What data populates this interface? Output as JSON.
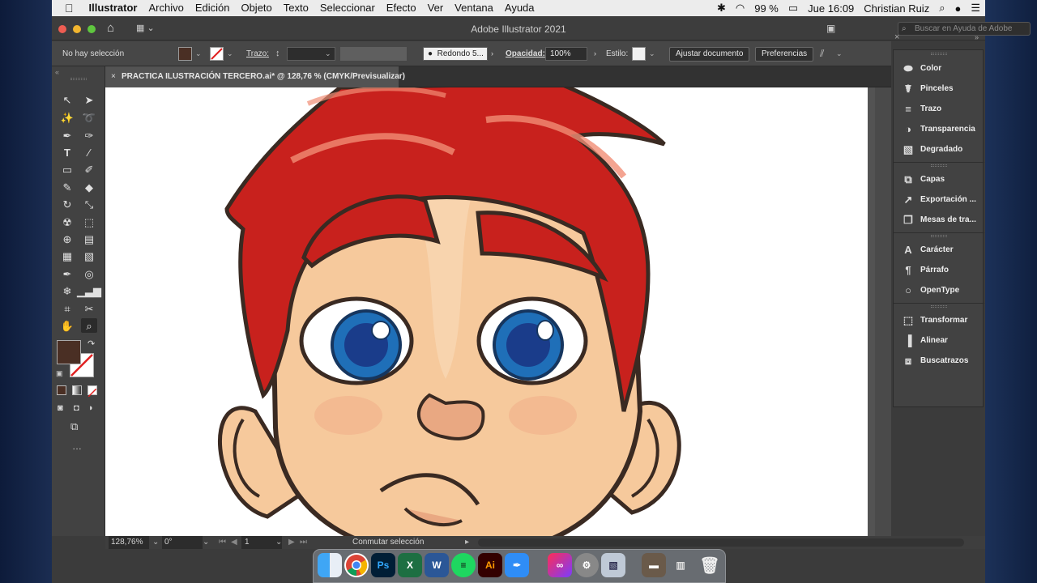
{
  "menubar": {
    "apple_icon": "apple-icon",
    "app_name": "Illustrator",
    "items": [
      "Archivo",
      "Edición",
      "Objeto",
      "Texto",
      "Seleccionar",
      "Efecto",
      "Ver",
      "Ventana",
      "Ayuda"
    ],
    "battery": "99 %",
    "clock": "Jue 16:09",
    "user": "Christian Ruiz"
  },
  "titlebar": {
    "title": "Adobe Illustrator 2021",
    "search_placeholder": "Buscar en Ayuda de Adobe"
  },
  "control_bar": {
    "selection": "No hay selección",
    "stroke_label": "Trazo:",
    "brush": "Redondo 5...",
    "opacity_label": "Opacidad:",
    "opacity_value": "100%",
    "style_label": "Estilo:",
    "doc_setup_button": "Ajustar documento",
    "preferences_button": "Preferencias",
    "fill_color": "#4a2f24"
  },
  "document_tab": {
    "close": "×",
    "label": "PRACTICA ILUSTRACIÓN TERCERO.ai* @ 128,76 % (CMYK/Previsualizar)"
  },
  "status_bar": {
    "zoom": "128,76%",
    "rotation": "0°",
    "artboard": "1",
    "info": "Conmutar selección"
  },
  "panels": [
    {
      "label": "Color",
      "icon": "color-palette-icon"
    },
    {
      "label": "Pinceles",
      "icon": "brush-icon"
    },
    {
      "label": "Trazo",
      "icon": "stroke-lines-icon"
    },
    {
      "label": "Transparencia",
      "icon": "transparency-icon"
    },
    {
      "label": "Degradado",
      "icon": "gradient-icon"
    },
    {
      "label": "Capas",
      "icon": "layers-icon"
    },
    {
      "label": "Exportación ...",
      "icon": "export-icon"
    },
    {
      "label": "Mesas de tra...",
      "icon": "artboards-icon"
    },
    {
      "label": "Carácter",
      "icon": "character-icon"
    },
    {
      "label": "Párrafo",
      "icon": "paragraph-icon"
    },
    {
      "label": "OpenType",
      "icon": "opentype-icon"
    },
    {
      "label": "Transformar",
      "icon": "transform-icon"
    },
    {
      "label": "Alinear",
      "icon": "align-icon"
    },
    {
      "label": "Buscatrazos",
      "icon": "pathfinder-icon"
    }
  ],
  "dock": [
    {
      "name": "Finder",
      "icon": "finder-icon"
    },
    {
      "name": "Chrome",
      "icon": "chrome-icon"
    },
    {
      "name": "Photoshop",
      "icon": "photoshop-icon",
      "text": "Ps"
    },
    {
      "name": "Excel",
      "icon": "excel-icon"
    },
    {
      "name": "Word",
      "icon": "word-icon"
    },
    {
      "name": "Spotify",
      "icon": "spotify-icon"
    },
    {
      "name": "Illustrator",
      "icon": "illustrator-icon",
      "text": "Ai"
    },
    {
      "name": "Pen",
      "icon": "pen-app-icon"
    },
    {
      "name": "Creative Cloud",
      "icon": "creative-cloud-icon"
    },
    {
      "name": "System Preferences",
      "icon": "system-preferences-icon"
    },
    {
      "name": "Preview",
      "icon": "preview-icon"
    },
    {
      "name": "Folder",
      "icon": "folder-icon"
    },
    {
      "name": "Downloads",
      "icon": "downloads-icon"
    },
    {
      "name": "Trash",
      "icon": "trash-icon"
    }
  ],
  "colors": {
    "hair": "#c8211d",
    "skin": "#f6c99c",
    "iris": "#1f6fb8",
    "outline": "#3a2a22"
  }
}
